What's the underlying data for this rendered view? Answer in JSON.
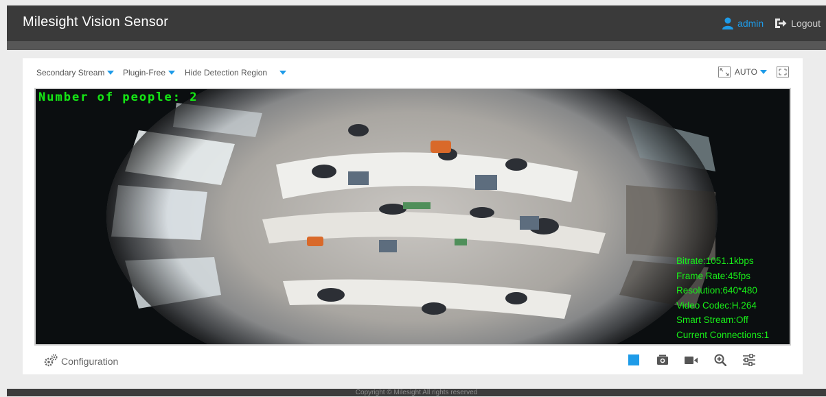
{
  "header": {
    "app_title": "Milesight Vision Sensor",
    "username": "admin",
    "logout_label": "Logout",
    "accent_color": "#1e9be8"
  },
  "toolbar": {
    "stream_label": "Secondary Stream",
    "plugin_label": "Plugin-Free",
    "region_label": "Hide Detection Region",
    "zoom_label": "AUTO"
  },
  "video": {
    "people_count_text": "Number of people: 2",
    "osd": {
      "bitrate": "Bitrate:1051.1kbps",
      "frame_rate": "Frame Rate:45fps",
      "resolution": "Resolution:640*480",
      "codec": "Video Codec:H.264",
      "smart_stream": "Smart Stream:Off",
      "connections": "Current Connections:1"
    }
  },
  "bottom": {
    "config_label": "Configuration",
    "icons": [
      "stop-icon",
      "snapshot-icon",
      "record-icon",
      "zoom-in-icon",
      "image-settings-icon"
    ]
  },
  "footer": {
    "copyright": "Copyright © Milesight All rights reserved"
  }
}
